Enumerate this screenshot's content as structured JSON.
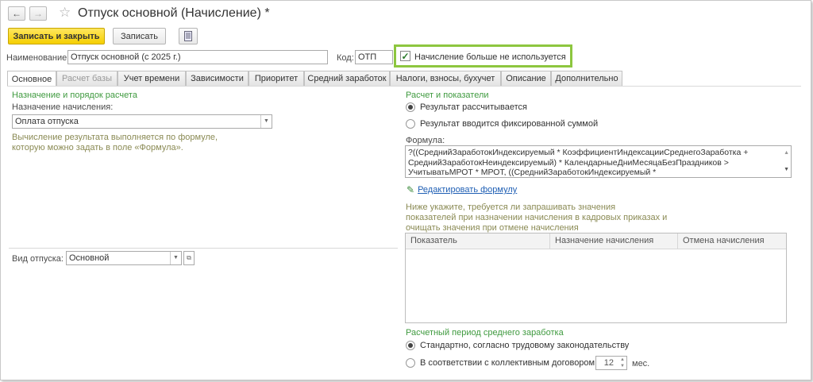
{
  "window": {
    "title": "Отпуск основной (Начисление) *"
  },
  "toolbar": {
    "save_close_label": "Записать и закрыть",
    "save_label": "Записать"
  },
  "header": {
    "name_label": "Наименование:",
    "name_value": "Отпуск основной (с 2025 г.)",
    "code_label": "Код:",
    "code_value": "ОТП",
    "unused_checkbox_label": "Начисление больше не используется",
    "unused_checked": true,
    "highlight_color": "#8dc63f"
  },
  "tabs": [
    {
      "label": "Основное",
      "active": true
    },
    {
      "label": "Расчет базы",
      "disabled": true
    },
    {
      "label": "Учет времени"
    },
    {
      "label": "Зависимости"
    },
    {
      "label": "Приоритет"
    },
    {
      "label": "Средний заработок"
    },
    {
      "label": "Налоги, взносы, бухучет"
    },
    {
      "label": "Описание"
    },
    {
      "label": "Дополнительно"
    }
  ],
  "left": {
    "section_title": "Назначение и порядок расчета",
    "purpose_label": "Назначение начисления:",
    "purpose_value": "Оплата отпуска",
    "hint_line1": "Вычисление результата выполняется по формуле,",
    "hint_line2": "которую можно задать в поле «Формула».",
    "vacation_type_label": "Вид отпуска:",
    "vacation_type_value": "Основной"
  },
  "right": {
    "section_title": "Расчет и показатели",
    "radio_calculated": "Результат рассчитывается",
    "radio_fixed": "Результат вводится фиксированной суммой",
    "formula_label": "Формула:",
    "formula_line1": "?((СреднийЗаработокИндексируемый * КоэффициентИндексацииСреднегоЗаработка +",
    "formula_line2": "СреднийЗаработокНеиндексируемый) * КалендарныеДниМесяцаБезПраздников >",
    "formula_line3": "УчитыватьМРОТ * МРОТ, ((СреднийЗаработокИндексируемый *",
    "edit_formula_link": "Редактировать формулу",
    "indicators_hint1": "Ниже укажите, требуется ли запрашивать значения",
    "indicators_hint2": "показателей при назначении начисления в кадровых приказах и",
    "indicators_hint3": "очищать значения при отмене начисления",
    "table_headers": [
      "Показатель",
      "Назначение начисления",
      "Отмена начисления"
    ],
    "period_title": "Расчетный период среднего заработка",
    "radio_standard": "Стандартно, согласно трудовому законодательству",
    "radio_collective": "В соответствии с коллективным договором",
    "months_value": "12",
    "months_unit": "мес."
  }
}
